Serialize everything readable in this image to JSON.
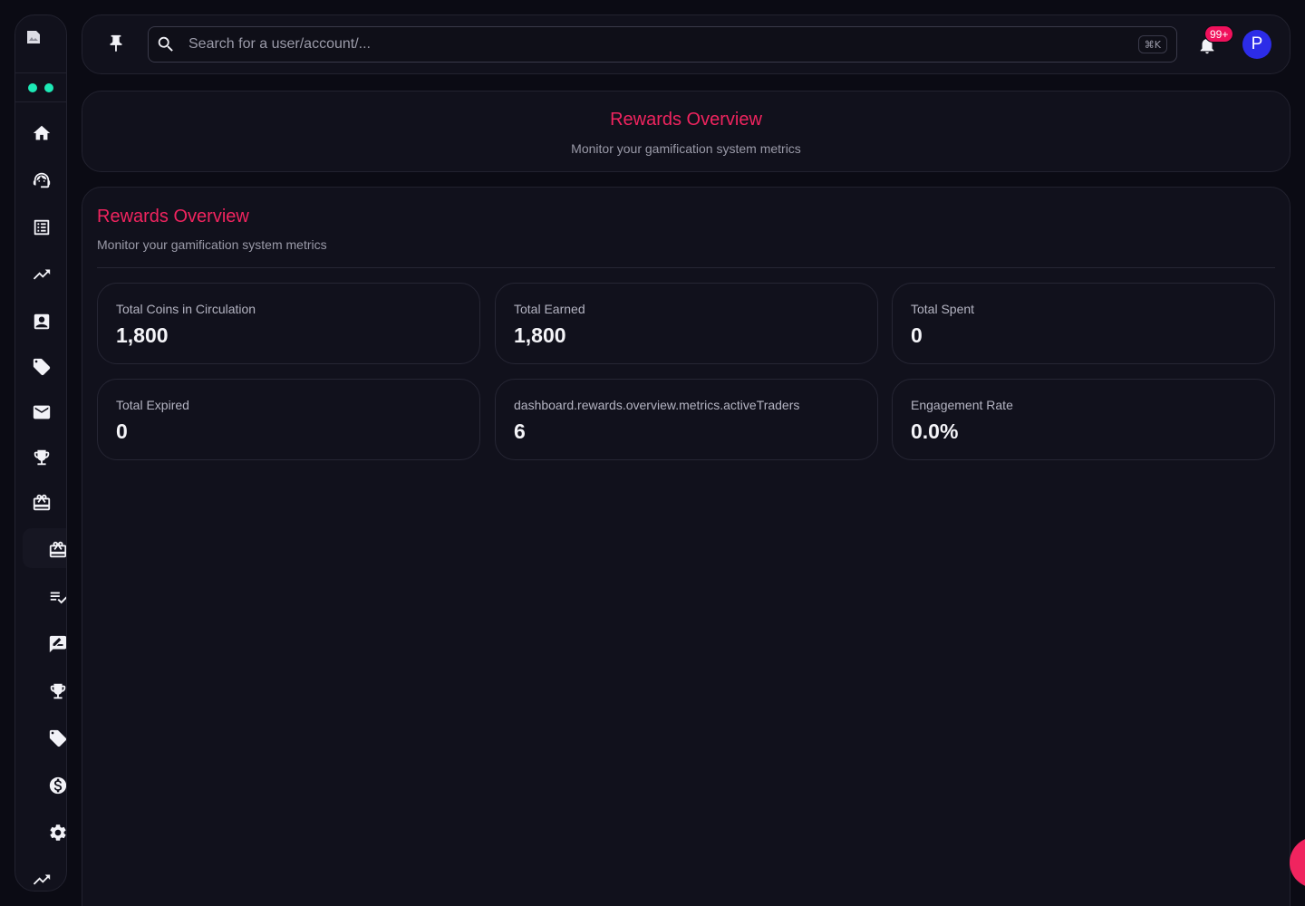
{
  "topbar": {
    "search_placeholder": "Search for a user/account/...",
    "shortcut": "⌘K",
    "notifications_badge": "99+",
    "avatar_initial": "P"
  },
  "header": {
    "title": "Rewards Overview",
    "subtitle": "Monitor your gamification system metrics"
  },
  "panel": {
    "title": "Rewards Overview",
    "subtitle": "Monitor your gamification system metrics",
    "metrics": [
      {
        "label": "Total Coins in Circulation",
        "value": "1,800"
      },
      {
        "label": "Total Earned",
        "value": "1,800"
      },
      {
        "label": "Total Spent",
        "value": "0"
      },
      {
        "label": "Total Expired",
        "value": "0"
      },
      {
        "label": "dashboard.rewards.overview.metrics.activeTraders",
        "value": "6"
      },
      {
        "label": "Engagement Rate",
        "value": "0.0%"
      }
    ]
  },
  "sidebar": {
    "items": [
      {
        "icon": "home-icon"
      },
      {
        "icon": "support-agent-icon"
      },
      {
        "icon": "list-alt-icon"
      },
      {
        "icon": "trending-up-icon"
      },
      {
        "icon": "contact-card-icon"
      },
      {
        "icon": "tag-icon"
      },
      {
        "icon": "mail-icon"
      },
      {
        "icon": "trophy-icon"
      },
      {
        "icon": "redeem-icon"
      },
      {
        "icon": "redeem-icon",
        "active": true
      },
      {
        "icon": "playlist-check-icon"
      },
      {
        "icon": "rate-review-icon"
      },
      {
        "icon": "trophy-icon"
      },
      {
        "icon": "tag-icon"
      },
      {
        "icon": "dollar-icon"
      },
      {
        "icon": "settings-icon"
      },
      {
        "icon": "trending-up-icon"
      }
    ],
    "status_color": "#1de9b6"
  },
  "colors": {
    "accent": "#f0245f",
    "background": "#0b0b14",
    "card": "#11111c",
    "avatar": "#2c2ce8"
  }
}
